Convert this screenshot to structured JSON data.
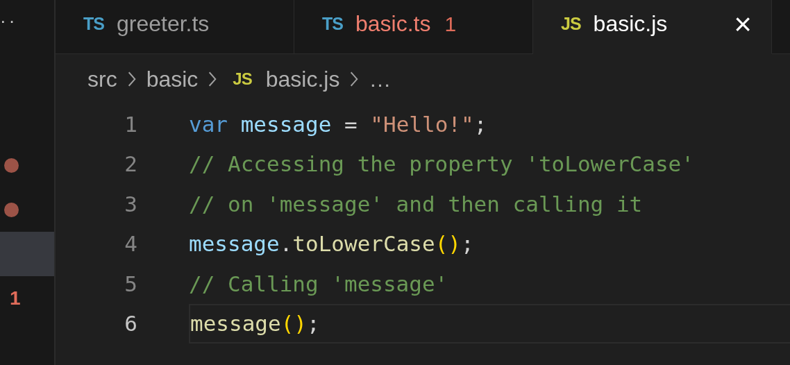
{
  "side_panel": {
    "more": "··",
    "items": [
      {
        "kind": "dot",
        "selected": false
      },
      {
        "kind": "dot",
        "selected": false
      },
      {
        "kind": "blank",
        "selected": true
      },
      {
        "kind": "count",
        "text": "1",
        "selected": false
      }
    ]
  },
  "tabs": [
    {
      "icon": "TS",
      "label": "greeter.ts",
      "selected": false,
      "has_error": false
    },
    {
      "icon": "TS",
      "label": "basic.ts",
      "selected": false,
      "has_error": true,
      "problems": "1"
    },
    {
      "icon": "JS",
      "label": "basic.js",
      "selected": true,
      "has_error": false,
      "close": "×"
    }
  ],
  "breadcrumb": [
    {
      "label": "src"
    },
    {
      "label": "basic"
    },
    {
      "icon": "JS",
      "label": "basic.js"
    },
    {
      "label": "…"
    }
  ],
  "lines": [
    {
      "number": "1",
      "current": false,
      "tokens": [
        {
          "kind": "keyword",
          "text": "var"
        },
        {
          "kind": "variable",
          "text": " message"
        },
        {
          "kind": "punct",
          "text": " = "
        },
        {
          "kind": "string",
          "text": "\"Hello!\""
        },
        {
          "kind": "punct",
          "text": ";"
        }
      ]
    },
    {
      "number": "2",
      "current": false,
      "tokens": [
        {
          "kind": "comment",
          "text": "// Accessing the property 'toLowerCase'"
        }
      ]
    },
    {
      "number": "3",
      "current": false,
      "tokens": [
        {
          "kind": "comment",
          "text": "// on 'message' and then calling it"
        }
      ]
    },
    {
      "number": "4",
      "current": false,
      "tokens": [
        {
          "kind": "variable",
          "text": "message"
        },
        {
          "kind": "punct",
          "text": "."
        },
        {
          "kind": "function",
          "text": "toLowerCase"
        },
        {
          "kind": "paren",
          "text": "()"
        },
        {
          "kind": "punct",
          "text": ";"
        }
      ]
    },
    {
      "number": "5",
      "current": false,
      "tokens": [
        {
          "kind": "comment",
          "text": "// Calling 'message'"
        }
      ]
    },
    {
      "number": "6",
      "current": true,
      "tokens": [
        {
          "kind": "function",
          "text": "message"
        },
        {
          "kind": "paren",
          "text": "()"
        },
        {
          "kind": "punct",
          "text": ";"
        }
      ]
    }
  ]
}
